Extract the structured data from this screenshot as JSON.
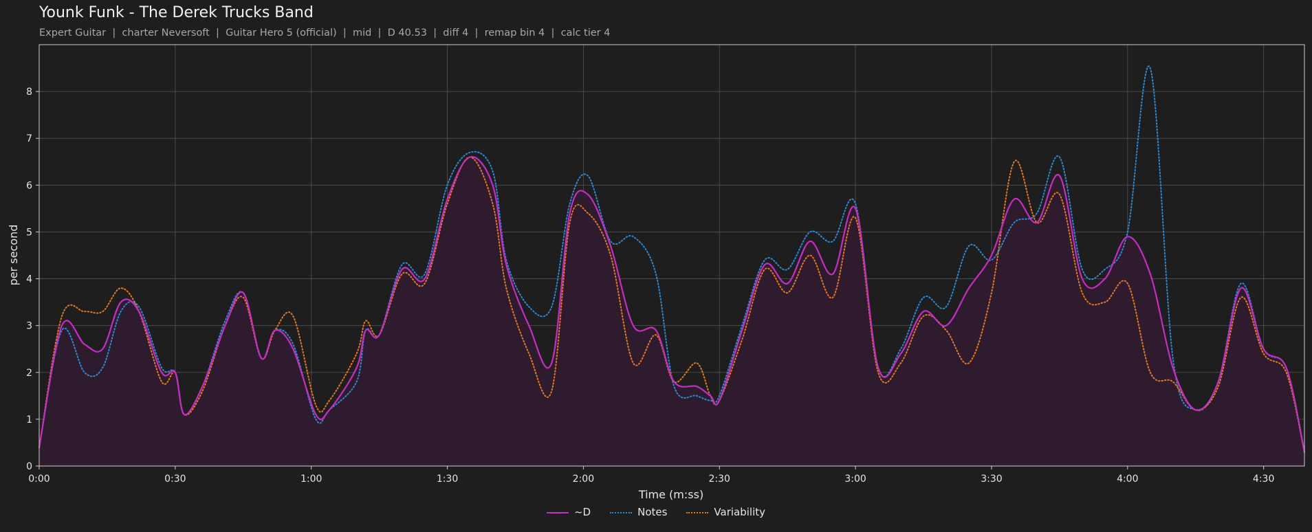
{
  "header": {
    "title": "Younk Funk - The Derek Trucks Band",
    "subtitle": "Expert Guitar  |  charter Neversoft  |  Guitar Hero 5 (official)  |  mid  |  D 40.53  |  diff 4  |  remap bin 4  |  calc tier 4"
  },
  "colors": {
    "background": "#1e1e1e",
    "plot_background": "#1e1e1e",
    "grid": "#4a4a4a",
    "d_line": "#c72cc4",
    "d_fill": "#2e1c2e",
    "notes": "#2b8cd6",
    "variability": "#e57a1f"
  },
  "chart_data": {
    "type": "line",
    "title": "Younk Funk - The Derek Trucks Band",
    "xlabel": "Time (m:ss)",
    "ylabel": "per second",
    "xlim": [
      0,
      279
    ],
    "ylim": [
      0,
      9
    ],
    "x_ticks": [
      0,
      30,
      60,
      90,
      120,
      150,
      180,
      210,
      240,
      270
    ],
    "x_tick_labels": [
      "0:00",
      "0:30",
      "1:00",
      "1:30",
      "2:00",
      "2:30",
      "3:00",
      "3:30",
      "4:00",
      "4:30"
    ],
    "y_ticks": [
      0,
      1,
      2,
      3,
      4,
      5,
      6,
      7,
      8
    ],
    "y_tick_labels": [
      "0",
      "1",
      "2",
      "3",
      "4",
      "5",
      "6",
      "7",
      "8"
    ],
    "grid": true,
    "legend_position": "bottom-center",
    "x": [
      0,
      5,
      10,
      14,
      18,
      22,
      27,
      30,
      32,
      36,
      41,
      45,
      49,
      52,
      56,
      61,
      64,
      70,
      72,
      75,
      80,
      85,
      90,
      95,
      100,
      103,
      108,
      113,
      117,
      121,
      126,
      131,
      136,
      140,
      145,
      148,
      150,
      155,
      160,
      165,
      170,
      175,
      180,
      185,
      190,
      195,
      200,
      205,
      210,
      215,
      220,
      225,
      230,
      235,
      240,
      245,
      250,
      255,
      260,
      265,
      270,
      275,
      279
    ],
    "series": [
      {
        "name": "~D",
        "style": "solid",
        "values": [
          0.4,
          3.0,
          2.6,
          2.5,
          3.5,
          3.3,
          2.0,
          2.0,
          1.1,
          1.7,
          3.0,
          3.7,
          2.3,
          2.9,
          2.5,
          1.1,
          1.2,
          2.1,
          2.9,
          2.8,
          4.2,
          4.0,
          5.7,
          6.6,
          6.0,
          4.3,
          3.0,
          2.2,
          5.4,
          5.8,
          4.7,
          3.0,
          2.9,
          1.8,
          1.7,
          1.5,
          1.4,
          2.9,
          4.3,
          3.9,
          4.8,
          4.1,
          5.5,
          2.1,
          2.4,
          3.3,
          3.0,
          3.8,
          4.5,
          5.7,
          5.2,
          6.2,
          4.0,
          4.0,
          4.9,
          4.1,
          2.1,
          1.2,
          1.8,
          3.8,
          2.5,
          2.1,
          0.3
        ]
      },
      {
        "name": "Notes",
        "style": "dotted",
        "values": [
          0.4,
          2.9,
          2.0,
          2.1,
          3.3,
          3.4,
          2.1,
          2.0,
          1.1,
          1.7,
          3.1,
          3.7,
          2.3,
          2.9,
          2.6,
          1.0,
          1.2,
          1.8,
          2.9,
          2.8,
          4.3,
          4.1,
          6.0,
          6.7,
          6.3,
          4.4,
          3.4,
          3.4,
          5.6,
          6.2,
          4.8,
          4.9,
          4.1,
          1.7,
          1.5,
          1.4,
          1.5,
          3.0,
          4.4,
          4.2,
          5.0,
          4.8,
          5.6,
          2.1,
          2.5,
          3.6,
          3.4,
          4.7,
          4.4,
          5.2,
          5.4,
          6.6,
          4.2,
          4.2,
          5.0,
          8.5,
          2.3,
          1.2,
          1.8,
          3.9,
          2.5,
          2.1,
          0.3
        ]
      },
      {
        "name": "Variability",
        "style": "dotted",
        "values": [
          0.4,
          3.2,
          3.3,
          3.3,
          3.8,
          3.3,
          1.8,
          2.0,
          1.1,
          1.6,
          3.0,
          3.6,
          2.3,
          2.9,
          3.2,
          1.3,
          1.4,
          2.4,
          3.1,
          2.8,
          4.1,
          3.9,
          5.6,
          6.6,
          5.6,
          3.8,
          2.4,
          1.6,
          5.2,
          5.4,
          4.5,
          2.2,
          2.8,
          1.8,
          2.2,
          1.5,
          1.4,
          2.7,
          4.2,
          3.7,
          4.5,
          3.6,
          5.3,
          2.0,
          2.2,
          3.2,
          2.9,
          2.2,
          3.7,
          6.5,
          5.2,
          5.8,
          3.7,
          3.5,
          3.9,
          2.0,
          1.8,
          1.2,
          1.7,
          3.6,
          2.4,
          2.0,
          0.3
        ]
      }
    ]
  }
}
